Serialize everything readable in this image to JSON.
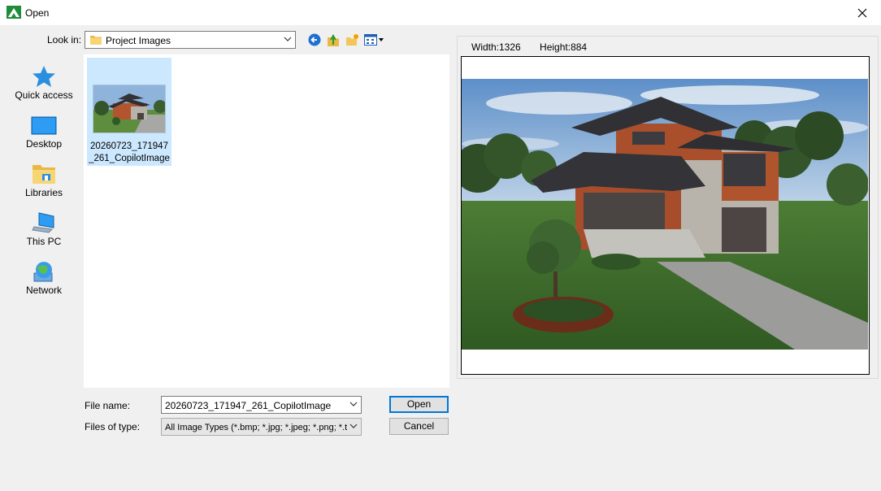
{
  "window": {
    "title": "Open"
  },
  "look_in": {
    "label": "Look in:",
    "value": "Project Images"
  },
  "places": [
    {
      "label": "Quick access",
      "icon": "star-icon"
    },
    {
      "label": "Desktop",
      "icon": "desktop-icon"
    },
    {
      "label": "Libraries",
      "icon": "libraries-icon"
    },
    {
      "label": "This PC",
      "icon": "computer-icon"
    },
    {
      "label": "Network",
      "icon": "network-icon"
    }
  ],
  "files": [
    {
      "name": "20260723_171947_261_CopilotImage",
      "selected": true
    }
  ],
  "file_name": {
    "label": "File name:",
    "value": "20260723_171947_261_CopilotImage"
  },
  "file_type": {
    "label": "Files of type:",
    "value": "All Image Types (*.bmp; *.jpg; *.jpeg; *.png; *.tiff"
  },
  "buttons": {
    "open": "Open",
    "cancel": "Cancel"
  },
  "preview": {
    "width_label": "Width:1326",
    "height_label": "Height:884"
  },
  "colors": {
    "selection": "#cce8ff",
    "accent": "#0078d7",
    "app_icon": "#1f8c3a"
  }
}
